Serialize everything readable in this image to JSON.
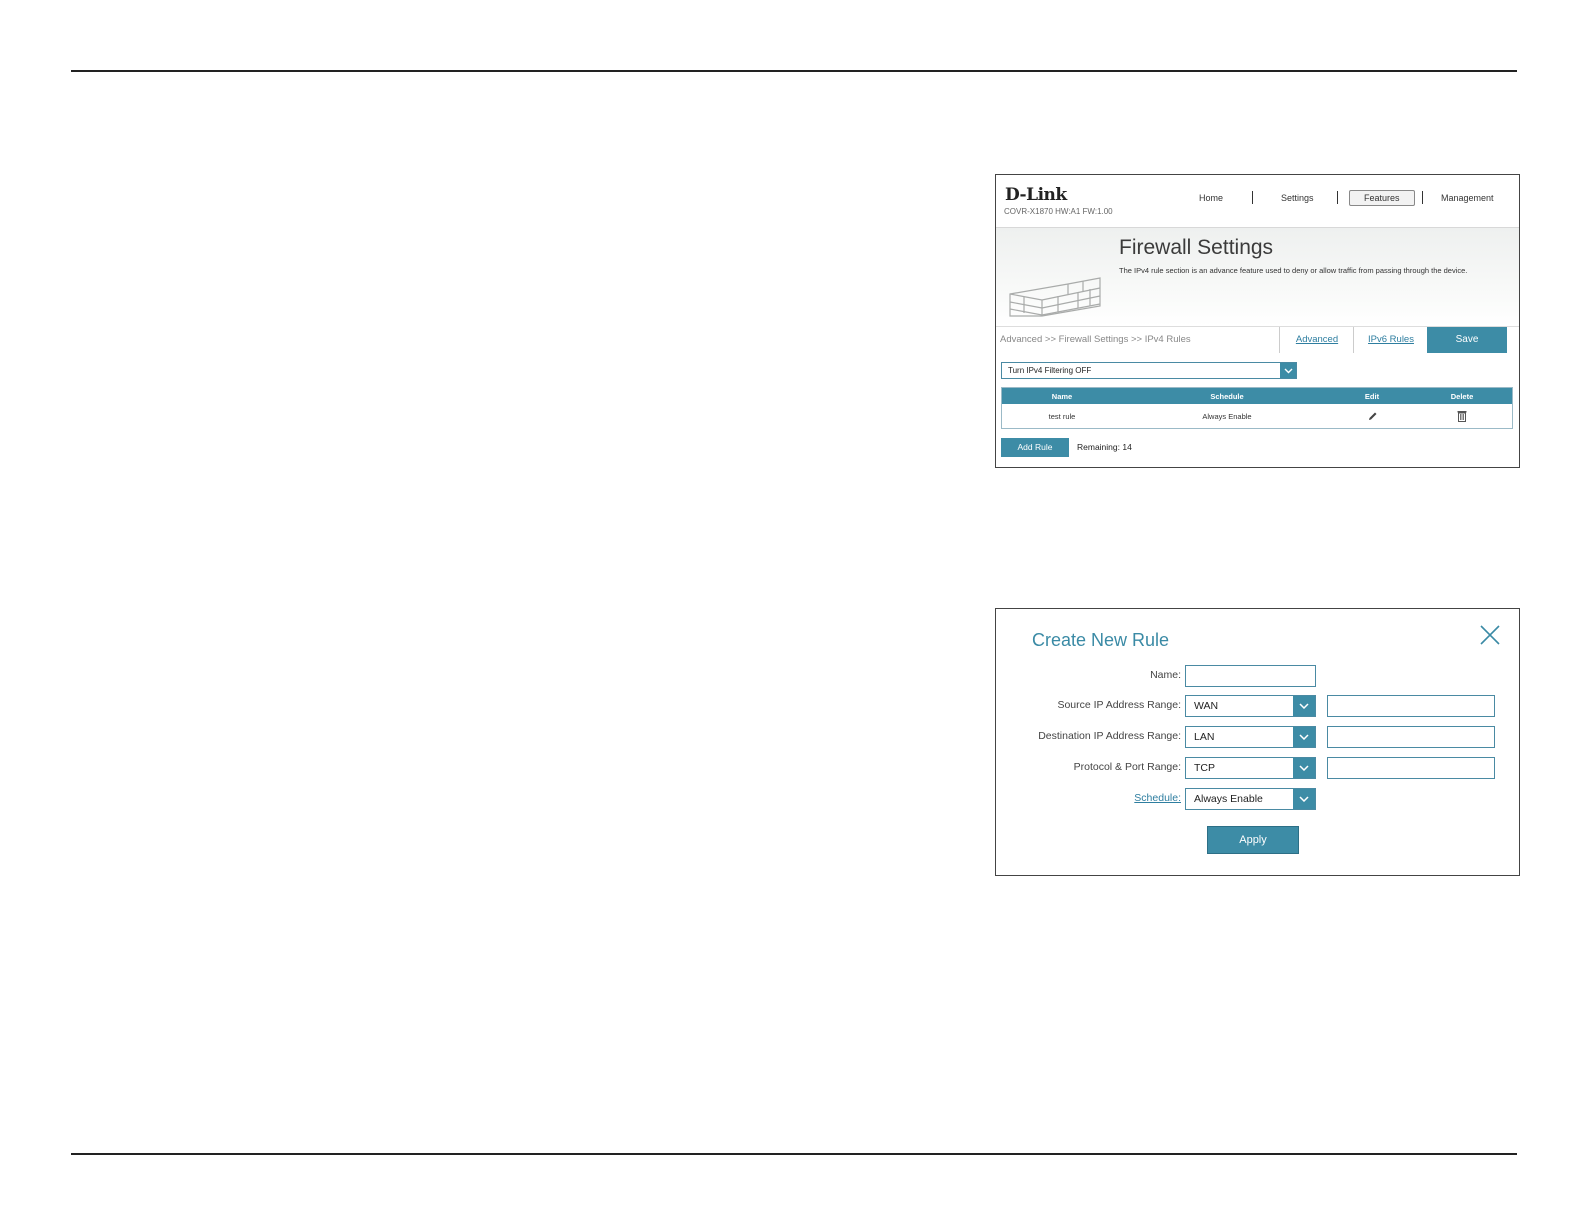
{
  "firewall": {
    "brand": "D-Link",
    "model": "COVR-X1870 HW:A1 FW:1.00",
    "nav": [
      "Home",
      "Settings",
      "Features",
      "Management"
    ],
    "title": "Firewall Settings",
    "description": "The IPv4 rule section is an advance feature used to deny or allow traffic from passing through the device.",
    "breadcrumb": "Advanced >> Firewall Settings >> IPv4 Rules",
    "tab_advanced": "Advanced",
    "tab_ipv6": "IPv6 Rules",
    "save": "Save",
    "filter_value": "Turn IPv4 Filtering OFF",
    "table": {
      "headers": [
        "Name",
        "Schedule",
        "Edit",
        "Delete"
      ],
      "rows": [
        {
          "name": "test rule",
          "schedule": "Always Enable"
        }
      ]
    },
    "add_rule": "Add Rule",
    "remaining": "Remaining: 14"
  },
  "dialog": {
    "title": "Create New Rule",
    "name_label": "Name:",
    "source_label": "Source IP Address Range:",
    "source_value": "WAN",
    "dest_label": "Destination IP Address Range:",
    "dest_value": "LAN",
    "protocol_label": "Protocol & Port Range:",
    "protocol_value": "TCP",
    "schedule_label": "Schedule:",
    "schedule_value": "Always Enable",
    "apply": "Apply"
  },
  "colors": {
    "accent": "#3d8ca6",
    "link": "#2e7ea0"
  }
}
